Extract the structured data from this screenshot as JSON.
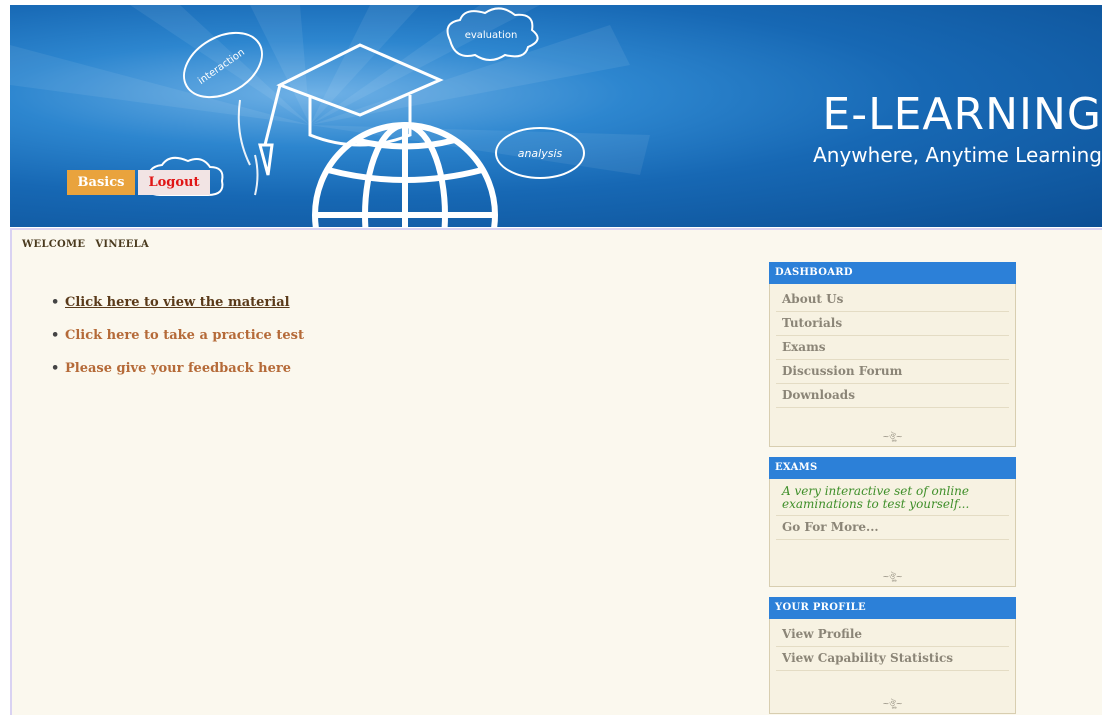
{
  "banner": {
    "title": "E-LEARNING",
    "tagline": "Anywhere, Anytime Learning",
    "cloud_interaction": "interaction",
    "cloud_evaluation": "evaluation",
    "cloud_analysis": "analysis",
    "basics_label": "Basics",
    "logout_label": "Logout",
    "colors": {
      "banner": "#1768b4",
      "basics": "#e9a33d",
      "logout_text": "#e01616"
    }
  },
  "welcome": {
    "label": "WELCOME",
    "user": "VINEELA"
  },
  "main_links": [
    {
      "label": "Click here to view the material",
      "active": true
    },
    {
      "label": "Click here to take a practice test",
      "active": false
    },
    {
      "label": "Please give your feedback here",
      "active": false
    }
  ],
  "dashboard": {
    "title": "DASHBOARD",
    "items": [
      "About Us",
      "Tutorials",
      "Exams",
      "Discussion Forum",
      "Downloads"
    ],
    "ornament": "~ঔৣ~"
  },
  "exams": {
    "title": "EXAMS",
    "description": "A very interactive set of online examinations to test yourself...",
    "more": "Go For More...",
    "ornament": "~ঔৣ~"
  },
  "profile": {
    "title": "YOUR PROFILE",
    "items": [
      "View Profile",
      "View Capability Statistics"
    ],
    "ornament": "~ঔৣ~"
  }
}
